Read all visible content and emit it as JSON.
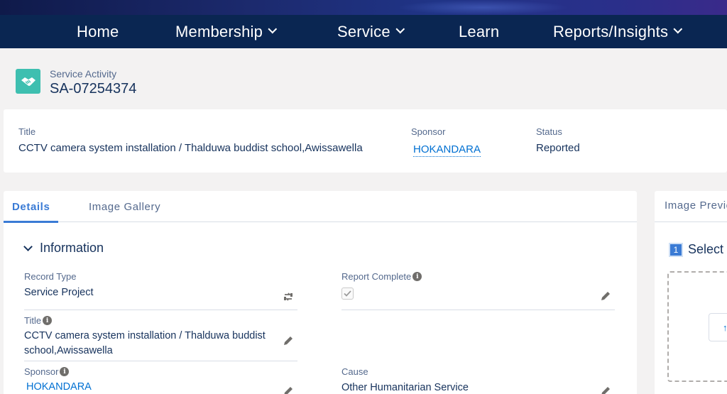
{
  "nav": {
    "home": "Home",
    "membership": "Membership",
    "service": "Service",
    "learn": "Learn",
    "reports": "Reports/Insights"
  },
  "record": {
    "object_type": "Service Activity",
    "name": "SA-07254374"
  },
  "highlights": {
    "title_label": "Title",
    "title_value": "CCTV camera system installation / Thalduwa buddist school,Awissawella",
    "sponsor_label": "Sponsor",
    "sponsor_value": "HOKANDARA",
    "status_label": "Status",
    "status_value": "Reported"
  },
  "tabs": {
    "details": "Details",
    "gallery": "Image Gallery"
  },
  "section": {
    "title": "Information"
  },
  "fields": {
    "record_type_label": "Record Type",
    "record_type_value": "Service Project",
    "report_complete_label": "Report Complete",
    "title_label": "Title",
    "title_value": "CCTV camera system installation / Thalduwa buddist school,Awissawella",
    "sponsor_label": "Sponsor",
    "sponsor_value": "HOKANDARA",
    "cause_label": "Cause",
    "cause_value": "Other Humanitarian Service"
  },
  "image_preview": {
    "tab": "Image Preview",
    "step_number": "1",
    "step_text": "Select"
  },
  "colors": {
    "nav_bg": "#0a2652",
    "accent": "#3a7bd5",
    "link": "#0070d2",
    "icon_bg": "#3ebfb0"
  }
}
